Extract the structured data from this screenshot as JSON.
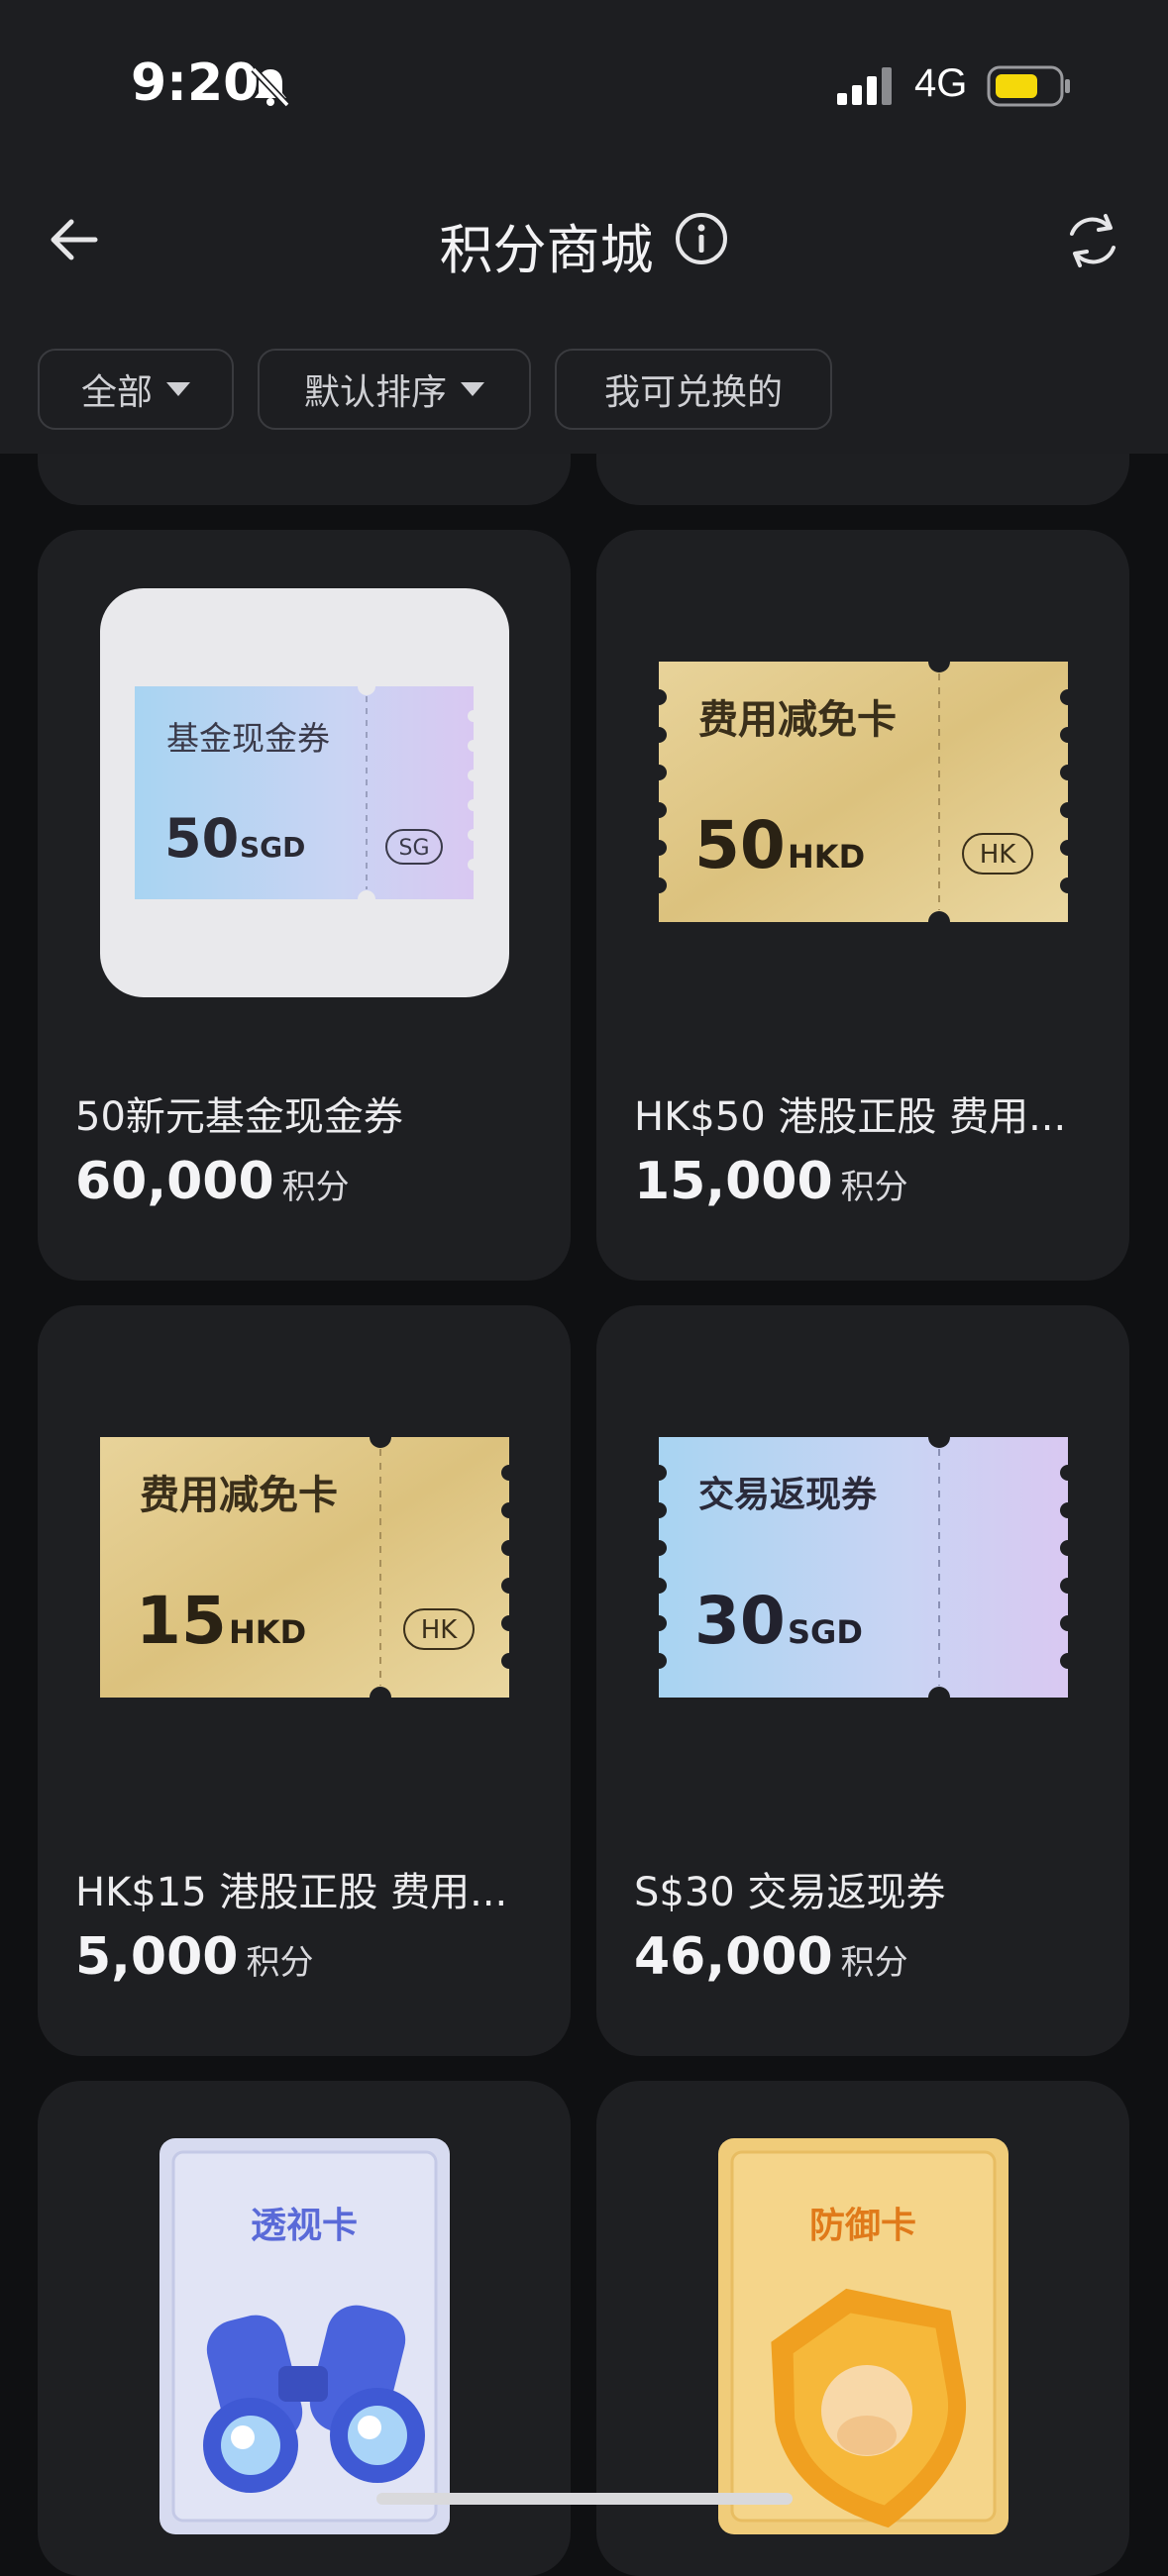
{
  "status_bar": {
    "time": "9:20",
    "network": "4G"
  },
  "nav": {
    "title": "积分商城"
  },
  "filters": [
    {
      "label": "全部"
    },
    {
      "label": "默认排序"
    },
    {
      "label": "我可兑换的"
    }
  ],
  "products": [
    {
      "name": "50新元基金现金券",
      "points": "60,000",
      "points_unit": "积分",
      "coupon": {
        "title": "基金现金券",
        "amount": "50",
        "currency": "SGD",
        "region": "SG",
        "style": "blue"
      }
    },
    {
      "name": "HK$50 港股正股 费用...",
      "points": "15,000",
      "points_unit": "积分",
      "coupon": {
        "title": "费用减免卡",
        "amount": "50",
        "currency": "HKD",
        "region": "HK",
        "style": "gold"
      }
    },
    {
      "name": "HK$15 港股正股 费用...",
      "points": "5,000",
      "points_unit": "积分",
      "coupon": {
        "title": "费用减免卡",
        "amount": "15",
        "currency": "HKD",
        "region": "HK",
        "style": "gold"
      }
    },
    {
      "name": "S$30 交易返现券",
      "points": "46,000",
      "points_unit": "积分",
      "coupon": {
        "title": "交易返现券",
        "amount": "30",
        "currency": "SGD",
        "region": "",
        "style": "blue"
      }
    },
    {
      "card": {
        "title": "透视卡",
        "icon": "binoculars-icon",
        "style": "lavender"
      }
    },
    {
      "card": {
        "title": "防御卡",
        "icon": "shield-icon",
        "style": "orange"
      }
    }
  ],
  "colors": {
    "gold": "#e2cc8c",
    "blue": "#b9d3ef",
    "accent_purple": "#5a6ad8",
    "accent_orange": "#e07a1a"
  }
}
